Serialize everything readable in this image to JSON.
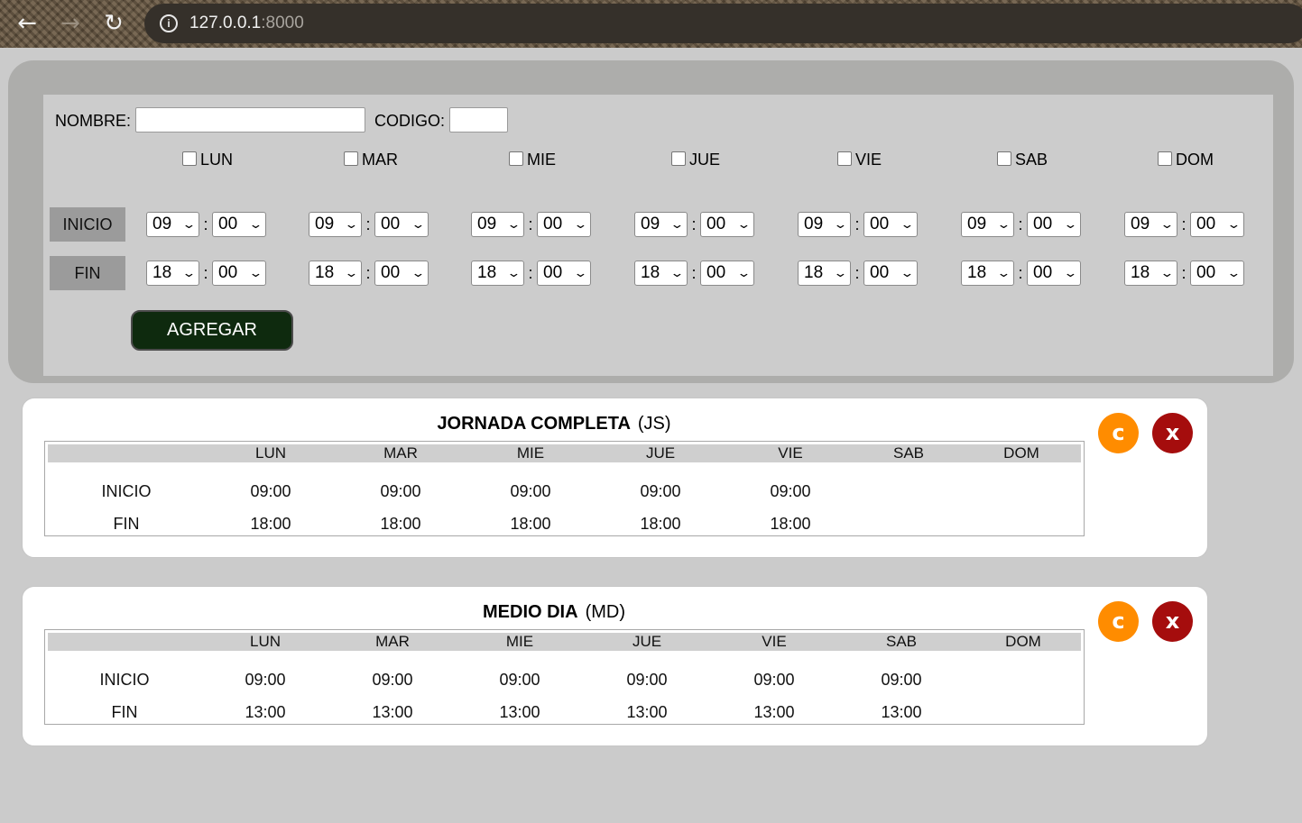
{
  "browser": {
    "url_host": "127.0.0.1",
    "url_port": ":8000"
  },
  "form": {
    "nombre_label": "NOMBRE:",
    "nombre_value": "",
    "codigo_label": "CODIGO:",
    "codigo_value": "",
    "days": [
      "LUN",
      "MAR",
      "MIE",
      "JUE",
      "VIE",
      "SAB",
      "DOM"
    ],
    "inicio_label": "INICIO",
    "fin_label": "FIN",
    "inicio_hour": "09",
    "inicio_min": "00",
    "fin_hour": "18",
    "fin_min": "00",
    "colon": ":",
    "submit_label": "AGREGAR"
  },
  "schedules": [
    {
      "name": "JORNADA COMPLETA",
      "code": "(JS)",
      "headers": [
        "LUN",
        "MAR",
        "MIE",
        "JUE",
        "VIE",
        "SAB",
        "DOM"
      ],
      "row_labels": [
        "INICIO",
        "FIN"
      ],
      "inicio": [
        "09:00",
        "09:00",
        "09:00",
        "09:00",
        "09:00",
        "",
        ""
      ],
      "fin": [
        "18:00",
        "18:00",
        "18:00",
        "18:00",
        "18:00",
        "",
        ""
      ],
      "edit_label": "c",
      "delete_label": "x"
    },
    {
      "name": "MEDIO DIA",
      "code": "(MD)",
      "headers": [
        "LUN",
        "MAR",
        "MIE",
        "JUE",
        "VIE",
        "SAB",
        "DOM"
      ],
      "row_labels": [
        "INICIO",
        "FIN"
      ],
      "inicio": [
        "09:00",
        "09:00",
        "09:00",
        "09:00",
        "09:00",
        "09:00",
        ""
      ],
      "fin": [
        "13:00",
        "13:00",
        "13:00",
        "13:00",
        "13:00",
        "13:00",
        ""
      ],
      "edit_label": "c",
      "delete_label": "x"
    }
  ],
  "colors": {
    "submit_bg": "#0e2a0e",
    "edit_btn": "#ff8c00",
    "delete_btn": "#a50d0d"
  }
}
